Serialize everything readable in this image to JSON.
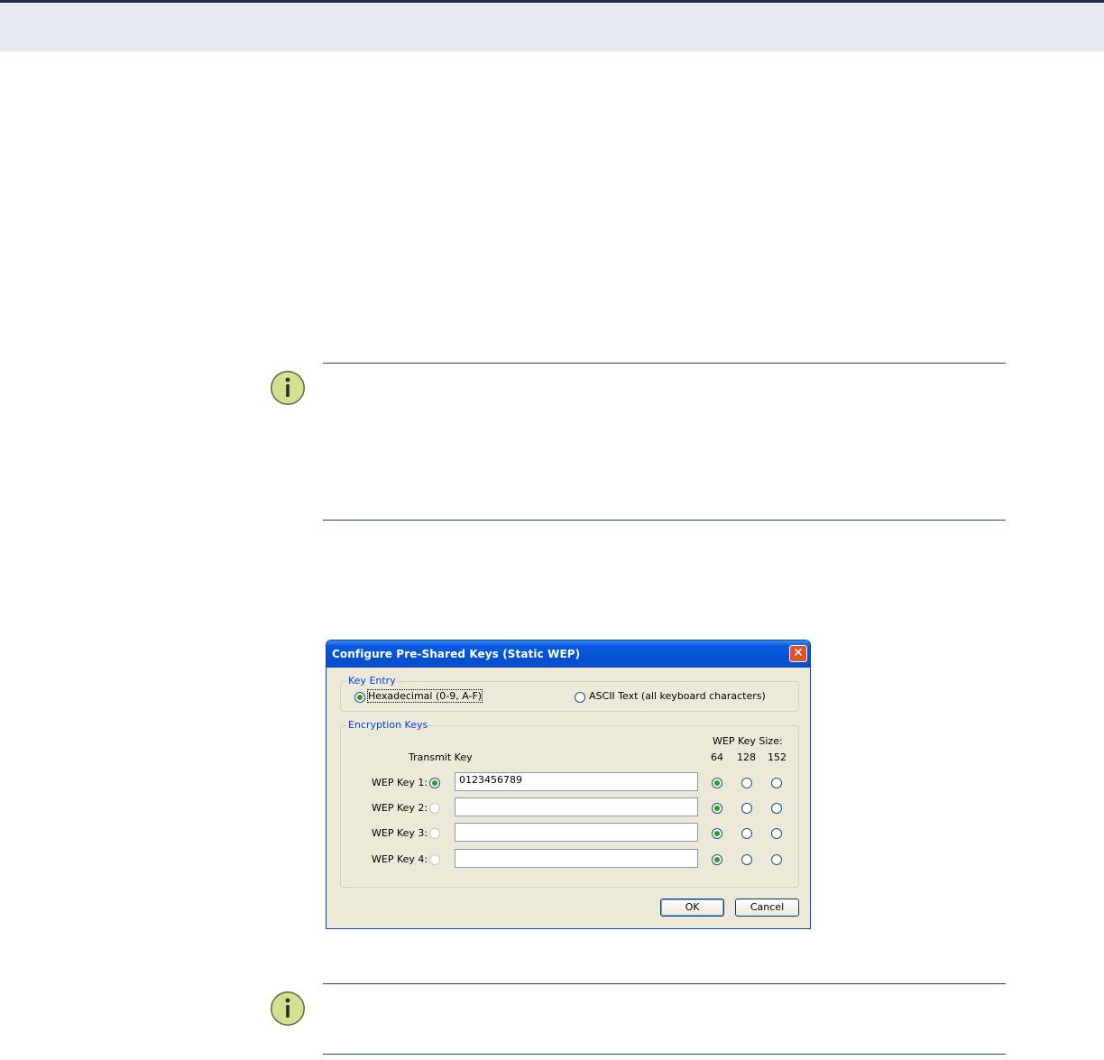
{
  "dialog": {
    "title": "Configure Pre-Shared Keys (Static WEP)",
    "close_label": "✕",
    "key_entry": {
      "legend": "Key Entry",
      "hex_label": "Hexadecimal (0-9, A-F)",
      "ascii_label": "ASCII Text (all keyboard characters)",
      "selected": "hex"
    },
    "encryption_keys": {
      "legend": "Encryption Keys",
      "transmit_header": "Transmit Key",
      "size_header": "WEP Key Size:",
      "size_options": [
        "64",
        "128",
        "152"
      ],
      "keys": [
        {
          "label": "WEP Key 1:",
          "value": "0123456789",
          "transmit_selected": true,
          "transmit_enabled": true,
          "size": "64"
        },
        {
          "label": "WEP Key 2:",
          "value": "",
          "transmit_selected": false,
          "transmit_enabled": false,
          "size": "64"
        },
        {
          "label": "WEP Key 3:",
          "value": "",
          "transmit_selected": false,
          "transmit_enabled": false,
          "size": "64"
        },
        {
          "label": "WEP Key 4:",
          "value": "",
          "transmit_selected": false,
          "transmit_enabled": false,
          "size": "64"
        }
      ]
    },
    "ok_label": "OK",
    "cancel_label": "Cancel"
  },
  "colors": {
    "header_band": "#e6e9f0",
    "header_rule": "#1b2b4c",
    "note_rule": "#2c3e66",
    "note_icon": "#d4df8f",
    "titlebar": "#0552d4",
    "dialog_bg": "#ece9d8"
  },
  "icons": [
    "info-icon",
    "close-icon"
  ]
}
